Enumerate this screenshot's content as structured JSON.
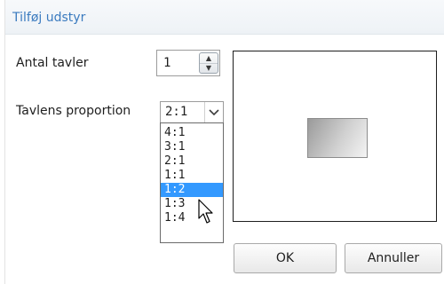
{
  "dialog": {
    "title": "Tilføj udstyr",
    "count_label": "Antal tavler",
    "count_value": "1",
    "proportion_label": "Tavlens proportion",
    "proportion_value": "2:1",
    "proportion_options": [
      "4:1",
      "3:1",
      "2:1",
      "1:1",
      "1:2",
      "1:3",
      "1:4"
    ],
    "highlighted_option": "1:2",
    "ok_label": "OK",
    "cancel_label": "Annuller"
  },
  "icons": {
    "spin_up": "chevron-up-icon",
    "spin_down": "chevron-down-icon",
    "combo_arrow": "chevron-down-icon",
    "cursor": "mouse-pointer-icon"
  },
  "colors": {
    "title": "#3b7bbf",
    "selection": "#3399ff"
  }
}
